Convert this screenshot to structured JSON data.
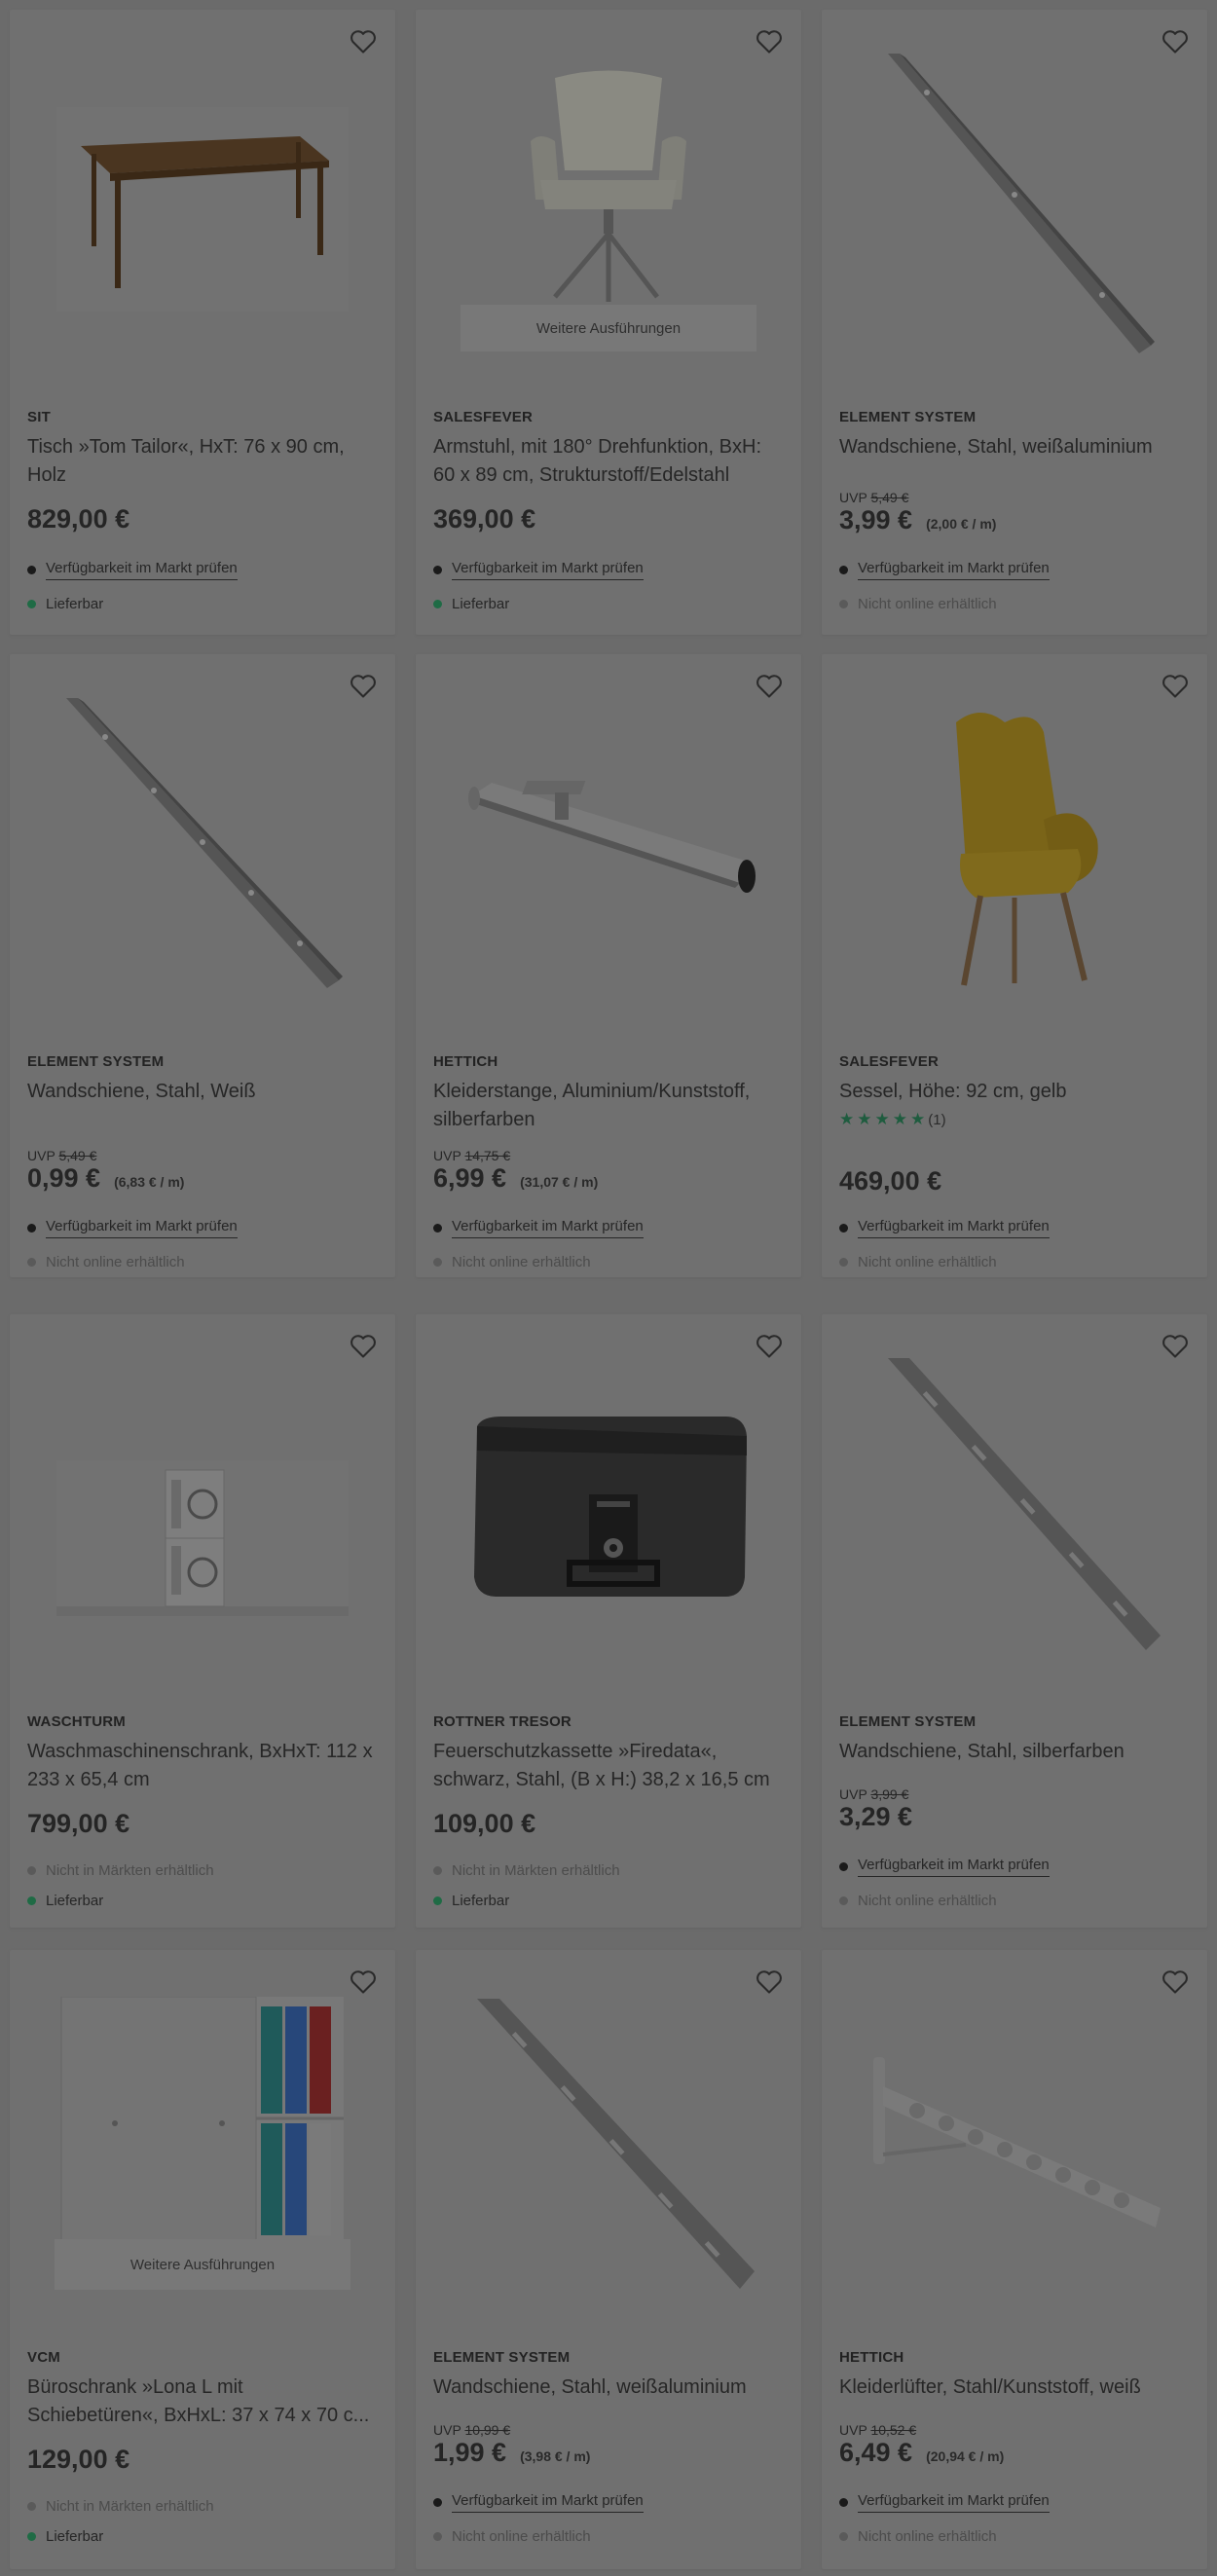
{
  "ui": {
    "variants_label": "Weitere Ausführungen",
    "check_store": "Verfügbarkeit im Markt prüfen",
    "deliverable": "Lieferbar",
    "not_online": "Nicht online erhältlich",
    "not_in_stores": "Nicht in Märkten erhältlich",
    "uvp": "UVP"
  },
  "products": [
    {
      "brand": "SIT",
      "title": "Tisch »Tom Tailor«, HxT: 76 x 90 cm, Holz",
      "uvp": "",
      "price": "829,00 €",
      "unit": "",
      "image": "table"
    },
    {
      "brand": "SALESFEVER",
      "title": "Armstuhl, mit 180° Drehfunktion, BxH: 60 x 89 cm, Strukturstoff/Edelstahl",
      "uvp": "",
      "price": "369,00 €",
      "unit": "",
      "image": "chair"
    },
    {
      "brand": "ELEMENT SYSTEM",
      "title": "Wandschiene, Stahl, weißaluminium",
      "uvp": "5,49 €",
      "price": "3,99 €",
      "unit": "(2,00 € / m)",
      "image": "rail"
    },
    {
      "brand": "ELEMENT SYSTEM",
      "title": "Wandschiene, Stahl, Weiß",
      "uvp": "5,49 €",
      "price": "0,99 €",
      "unit": "(6,83 € / m)",
      "image": "rail"
    },
    {
      "brand": "HETTICH",
      "title": "Kleiderstange, Aluminium/Kunststoff, silberfarben",
      "uvp": "14,75 €",
      "price": "6,99 €",
      "unit": "(31,07 € / m)",
      "image": "clothes-rod"
    },
    {
      "brand": "SALESFEVER",
      "title": "Sessel, Höhe: 92 cm, gelb",
      "rating_count": "(1)",
      "uvp": "",
      "price": "469,00 €",
      "unit": "",
      "image": "armchair"
    },
    {
      "brand": "WASCHTURM",
      "title": "Waschmaschinenschrank, BxHxT: 112 x 233 x 65,4 cm",
      "uvp": "",
      "price": "799,00 €",
      "unit": "",
      "image": "washtower"
    },
    {
      "brand": "ROTTNER TRESOR",
      "title": "Feuerschutzkassette »Firedata«, schwarz, Stahl, (B x H:) 38,2 x 16,5 cm",
      "uvp": "",
      "price": "109,00 €",
      "unit": "",
      "image": "safe-box"
    },
    {
      "brand": "ELEMENT SYSTEM",
      "title": "Wandschiene, Stahl, silberfarben",
      "uvp": "3,99 €",
      "price": "3,29 €",
      "unit": "",
      "image": "rail-wide"
    },
    {
      "brand": "VCM",
      "title": "Büroschrank »Lona L mit Schiebetüren«, BxHxL: 37 x 74 x 70 c...",
      "uvp": "",
      "price": "129,00 €",
      "unit": "",
      "image": "cabinet"
    },
    {
      "brand": "ELEMENT SYSTEM",
      "title": "Wandschiene, Stahl, weißaluminium",
      "uvp": "10,99 €",
      "price": "1,99 €",
      "unit": "(3,98 € / m)",
      "image": "rail-wide"
    },
    {
      "brand": "HETTICH",
      "title": "Kleiderlüfter, Stahl/Kunststoff, weiß",
      "uvp": "10,52 €",
      "price": "6,49 €",
      "unit": "(20,94 € / m)",
      "image": "clothes-airer"
    }
  ]
}
